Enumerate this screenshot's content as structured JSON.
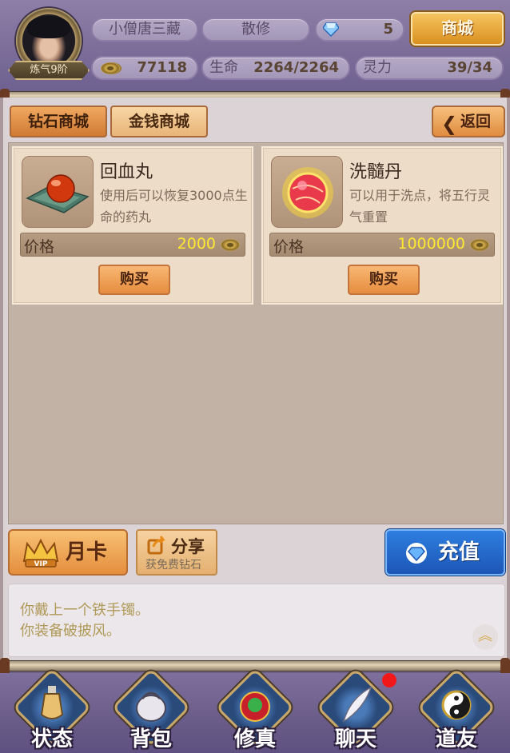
{
  "player": {
    "name": "小僧唐三藏",
    "sect": "散修",
    "diamonds": "5",
    "rank": "炼气9阶",
    "gold": "77118",
    "hp_label": "生命",
    "hp_value": "2264/2264",
    "spirit_label": "灵力",
    "spirit_value": "39/34"
  },
  "header": {
    "shop_label": "商城"
  },
  "tabs": [
    {
      "label": "钻石商城",
      "active": true
    },
    {
      "label": "金钱商城",
      "active": false
    }
  ],
  "back_label": "返回",
  "items": [
    {
      "name": "回血丸",
      "desc": "使用后可以恢复3000点生命的药丸",
      "price_label": "价格",
      "price": "2000",
      "buy_label": "购买",
      "icon": "red-pill-icon"
    },
    {
      "name": "洗髓丹",
      "desc": "可以用于洗点，将五行灵气重置",
      "price_label": "价格",
      "price": "1000000",
      "buy_label": "购买",
      "icon": "glowing-orb-icon"
    }
  ],
  "actions": {
    "vip_label": "月卡",
    "share_label": "分享",
    "share_sub": "获免费钻石",
    "recharge_label": "充值"
  },
  "log": [
    "你戴上一个铁手镯。",
    "你装备破披风。"
  ],
  "nav": [
    {
      "label": "状态",
      "icon": "potion-icon"
    },
    {
      "label": "背包",
      "icon": "bag-icon"
    },
    {
      "label": "修真",
      "icon": "cultivation-icon"
    },
    {
      "label": "聊天",
      "icon": "feather-icon"
    },
    {
      "label": "道友",
      "icon": "yin-yang-icon"
    }
  ],
  "colors": {
    "price": "#ffe832",
    "recharge": "#1c56b6",
    "accent": "#e68c3e"
  }
}
